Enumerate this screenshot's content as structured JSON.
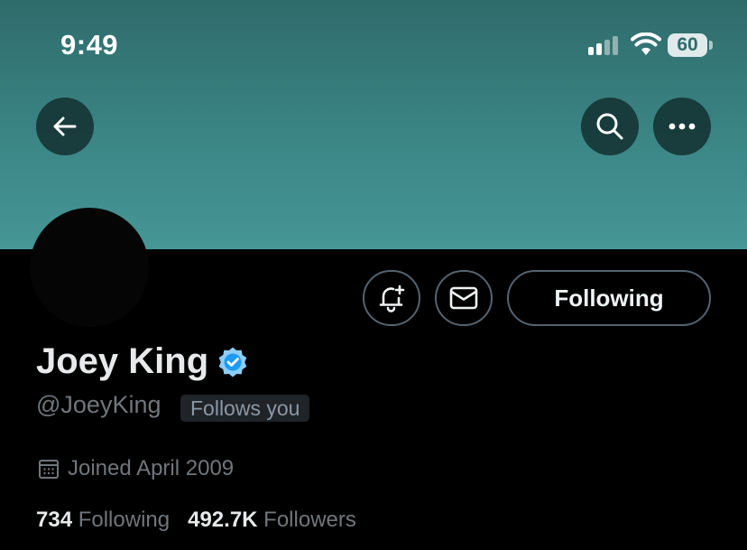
{
  "status_bar": {
    "time": "9:49",
    "battery": "60"
  },
  "profile": {
    "name": "Joey King",
    "handle": "@JoeyKing",
    "follows_you": "Follows you",
    "joined": "Joined April 2009",
    "following_count": "734",
    "following_label": "Following",
    "followers_count": "492.7K",
    "followers_label": "Followers"
  },
  "actions": {
    "following_button": "Following"
  },
  "icons": {
    "back": "back-arrow-icon",
    "search": "search-icon",
    "more": "more-icon",
    "notify": "bell-plus-icon",
    "message": "mail-icon",
    "verified": "verified-badge-icon",
    "calendar": "calendar-icon"
  },
  "colors": {
    "banner": "#3b8585",
    "verified": "#1d9bf0",
    "background": "#000000"
  }
}
